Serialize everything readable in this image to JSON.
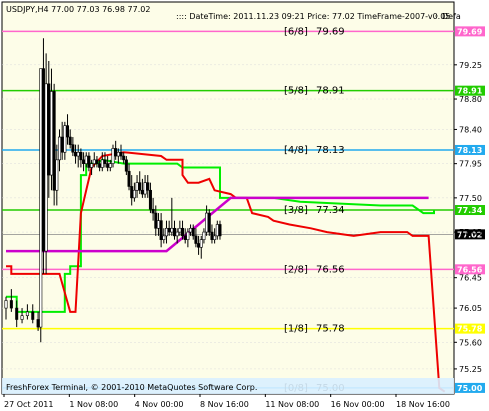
{
  "window": {
    "symbol_header": "USDJPY,H4  77.00 77.03 76.98 77.02",
    "info_line": ":::: DateTime: 2011.11.23 09:21   Price: 77.02   TimeFrame-2007-v0.05",
    "corner_label": "Defa",
    "footer": "FreshForex Terminal, © 2001-2010 MetaQuotes Software Corp."
  },
  "colors": {
    "frame_bg": "#fdfde8",
    "grid": "#dcdcdc",
    "candles": "#000000",
    "fast_line": "#00ee00",
    "slow_line": "#ee0000",
    "magenta_line": "#cc00cc",
    "current_price": "#888888"
  },
  "chart_data": {
    "type": "line",
    "ylim": [
      74.92,
      80.05
    ],
    "y_ticks": [
      "79.25",
      "78.80",
      "78.40",
      "77.95",
      "77.50",
      "77.05",
      "76.45",
      "76.05",
      "75.60",
      "75.25"
    ],
    "x_ticks": [
      "27 Oct 2011",
      "1 Nov 08:00",
      "4 Nov 00:00",
      "8 Nov 16:00",
      "11 Nov 08:00",
      "16 Nov 00:00",
      "18 Nov 16:00"
    ],
    "levels": [
      {
        "tag": "[6/8]",
        "price": 79.69,
        "price_label": "79.69",
        "color": "#ff66cc",
        "label_color": "#ff66cc"
      },
      {
        "tag": "[5/8]",
        "price": 78.91,
        "price_label": "78.91",
        "color": "#22cc00",
        "label_color": "#22bb00"
      },
      {
        "tag": "[4/8]",
        "price": 78.13,
        "price_label": "78.13",
        "color": "#22aaee",
        "label_color": "#22aaee"
      },
      {
        "tag": "[3/8]",
        "price": 77.34,
        "price_label": "77.34",
        "color": "#22cc00",
        "label_color": "#22bb00"
      },
      {
        "tag": "[2/8]",
        "price": 76.56,
        "price_label": "76.56",
        "color": "#ff66cc",
        "label_color": "#ff66cc"
      },
      {
        "tag": "[1/8]",
        "price": 75.78,
        "price_label": "75.78",
        "color": "#ffff00",
        "label_color": "#dddd00"
      },
      {
        "tag": "[0/8]",
        "price": 75.0,
        "price_label": "75.00",
        "color": "#22aaee",
        "label_color": "#22aaee"
      }
    ],
    "current_price": {
      "value": 77.02,
      "label": "77.02"
    },
    "magenta_level": {
      "value": 77.5,
      "label": "77.50"
    },
    "series": [
      {
        "color": "#00ee00",
        "points": [
          [
            0,
            76.2
          ],
          [
            4,
            76.2
          ],
          [
            4,
            76.0
          ],
          [
            14,
            76.0
          ],
          [
            22,
            76.0
          ],
          [
            22,
            76.5
          ],
          [
            24,
            76.5
          ],
          [
            24,
            76.6
          ],
          [
            28,
            76.6
          ],
          [
            28,
            77.8
          ],
          [
            30,
            77.8
          ],
          [
            30,
            77.95
          ],
          [
            34,
            77.95
          ],
          [
            36,
            78.0
          ],
          [
            44,
            77.95
          ],
          [
            58,
            77.95
          ],
          [
            64,
            77.95
          ],
          [
            66,
            77.9
          ],
          [
            80,
            77.9
          ],
          [
            80,
            77.5
          ],
          [
            100,
            77.5
          ],
          [
            110,
            77.45
          ],
          [
            140,
            77.4
          ],
          [
            152,
            77.4
          ],
          [
            156,
            77.3
          ],
          [
            160,
            77.3
          ],
          [
            160,
            77.34
          ]
        ]
      },
      {
        "color": "#ee0000",
        "points": [
          [
            0,
            76.6
          ],
          [
            2,
            76.6
          ],
          [
            2,
            76.5
          ],
          [
            10,
            76.5
          ],
          [
            14,
            76.5
          ],
          [
            20,
            76.5
          ],
          [
            24,
            76.0
          ],
          [
            26,
            76.0
          ],
          [
            28,
            77.3
          ],
          [
            30,
            77.6
          ],
          [
            32,
            77.9
          ],
          [
            36,
            78.05
          ],
          [
            44,
            78.1
          ],
          [
            58,
            78.05
          ],
          [
            60,
            78.0
          ],
          [
            66,
            78.0
          ],
          [
            66,
            77.8
          ],
          [
            68,
            77.7
          ],
          [
            72,
            77.7
          ],
          [
            76,
            77.75
          ],
          [
            78,
            77.6
          ],
          [
            84,
            77.55
          ],
          [
            86,
            77.5
          ],
          [
            90,
            77.5
          ],
          [
            92,
            77.3
          ],
          [
            98,
            77.25
          ],
          [
            100,
            77.2
          ],
          [
            106,
            77.15
          ],
          [
            114,
            77.1
          ],
          [
            120,
            77.05
          ],
          [
            130,
            77.0
          ],
          [
            140,
            77.05
          ],
          [
            150,
            77.05
          ],
          [
            152,
            77.0
          ],
          [
            158,
            77.0
          ],
          [
            162,
            75.0
          ],
          [
            164,
            74.95
          ]
        ]
      }
    ],
    "magenta_series": [
      [
        0,
        76.8
      ],
      [
        40,
        76.8
      ],
      [
        60,
        76.8
      ],
      [
        84,
        77.5
      ],
      [
        116,
        77.5
      ],
      [
        156,
        77.5
      ],
      [
        158,
        77.5
      ]
    ],
    "candles": [
      [
        0,
        76.05,
        76.2,
        75.9,
        76.15
      ],
      [
        2,
        76.15,
        76.3,
        76.0,
        76.05
      ],
      [
        4,
        76.05,
        76.15,
        75.8,
        75.9
      ],
      [
        6,
        75.9,
        76.05,
        75.85,
        75.95
      ],
      [
        8,
        75.95,
        76.1,
        75.9,
        76.0
      ],
      [
        10,
        76.0,
        76.1,
        75.85,
        75.9
      ],
      [
        12,
        75.9,
        76.0,
        75.75,
        75.8
      ],
      [
        13,
        75.8,
        79.0,
        75.6,
        79.2
      ],
      [
        14,
        79.2,
        79.6,
        76.5,
        76.8
      ],
      [
        15,
        76.8,
        79.4,
        76.5,
        79.0
      ],
      [
        16,
        79.0,
        79.3,
        77.5,
        77.8
      ],
      [
        17,
        77.8,
        79.2,
        77.6,
        78.9
      ],
      [
        18,
        78.9,
        79.0,
        77.4,
        77.6
      ],
      [
        19,
        77.6,
        78.2,
        77.4,
        78.0
      ],
      [
        20,
        78.0,
        78.4,
        77.85,
        78.3
      ],
      [
        21,
        78.3,
        78.5,
        78.0,
        78.1
      ],
      [
        22,
        78.1,
        78.5,
        78.0,
        78.45
      ],
      [
        23,
        78.45,
        78.6,
        78.2,
        78.3
      ],
      [
        24,
        78.3,
        78.4,
        78.15,
        78.2
      ],
      [
        25,
        78.2,
        78.3,
        78.05,
        78.1
      ],
      [
        26,
        78.1,
        78.2,
        77.95,
        78.05
      ],
      [
        27,
        78.05,
        78.2,
        77.9,
        78.1
      ],
      [
        28,
        78.1,
        78.15,
        77.9,
        78.0
      ],
      [
        29,
        78.0,
        78.1,
        77.85,
        77.95
      ],
      [
        30,
        77.95,
        78.1,
        77.9,
        78.05
      ],
      [
        31,
        78.05,
        78.1,
        77.85,
        77.9
      ],
      [
        32,
        77.9,
        78.0,
        77.8,
        77.95
      ],
      [
        33,
        77.95,
        78.1,
        77.9,
        78.0
      ],
      [
        34,
        78.0,
        78.05,
        77.9,
        77.95
      ],
      [
        35,
        77.95,
        78.0,
        77.85,
        77.9
      ],
      [
        36,
        77.9,
        78.1,
        77.85,
        78.0
      ],
      [
        37,
        78.0,
        78.1,
        77.9,
        77.95
      ],
      [
        38,
        77.95,
        78.05,
        77.85,
        77.9
      ],
      [
        39,
        77.9,
        78.0,
        77.85,
        77.95
      ],
      [
        40,
        77.95,
        78.2,
        77.9,
        78.15
      ],
      [
        41,
        78.15,
        78.25,
        78.0,
        78.05
      ],
      [
        42,
        78.05,
        78.15,
        77.95,
        78.1
      ],
      [
        43,
        78.1,
        78.2,
        78.0,
        78.05
      ],
      [
        44,
        78.05,
        78.1,
        77.95,
        78.0
      ],
      [
        45,
        78.0,
        78.05,
        77.8,
        77.85
      ],
      [
        46,
        77.85,
        77.95,
        77.6,
        77.65
      ],
      [
        47,
        77.65,
        77.8,
        77.4,
        77.5
      ],
      [
        48,
        77.5,
        77.7,
        77.45,
        77.6
      ],
      [
        49,
        77.6,
        77.8,
        77.5,
        77.7
      ],
      [
        50,
        77.7,
        77.85,
        77.55,
        77.6
      ],
      [
        51,
        77.6,
        77.75,
        77.5,
        77.55
      ],
      [
        52,
        77.55,
        77.8,
        77.5,
        77.7
      ],
      [
        53,
        77.7,
        77.8,
        77.5,
        77.6
      ],
      [
        54,
        77.6,
        77.7,
        77.3,
        77.35
      ],
      [
        55,
        77.35,
        77.5,
        77.2,
        77.3
      ],
      [
        56,
        77.3,
        77.4,
        77.0,
        77.1
      ],
      [
        57,
        77.1,
        77.3,
        77.0,
        77.2
      ],
      [
        58,
        77.2,
        77.3,
        76.85,
        76.95
      ],
      [
        59,
        76.95,
        77.1,
        76.9,
        77.0
      ],
      [
        60,
        77.0,
        77.2,
        76.9,
        77.1
      ],
      [
        61,
        77.1,
        77.2,
        77.0,
        77.05
      ],
      [
        62,
        77.05,
        77.5,
        77.0,
        77.1
      ],
      [
        63,
        77.1,
        77.2,
        76.95,
        77.0
      ],
      [
        64,
        77.0,
        77.1,
        76.9,
        77.05
      ],
      [
        65,
        77.05,
        77.2,
        77.0,
        77.1
      ],
      [
        66,
        77.1,
        77.2,
        76.95,
        77.0
      ],
      [
        67,
        77.0,
        77.1,
        76.9,
        76.95
      ],
      [
        68,
        76.95,
        77.1,
        76.85,
        77.05
      ],
      [
        69,
        77.05,
        77.15,
        77.0,
        77.1
      ],
      [
        70,
        77.1,
        77.15,
        76.95,
        77.0
      ],
      [
        71,
        77.0,
        77.1,
        76.85,
        76.9
      ],
      [
        72,
        76.9,
        77.0,
        76.75,
        76.85
      ],
      [
        73,
        76.85,
        77.0,
        76.7,
        76.95
      ],
      [
        74,
        76.95,
        77.1,
        76.9,
        77.05
      ],
      [
        75,
        77.05,
        77.4,
        77.0,
        77.3
      ],
      [
        76,
        77.3,
        77.35,
        77.0,
        77.05
      ],
      [
        77,
        77.05,
        77.15,
        76.9,
        76.95
      ],
      [
        78,
        76.95,
        77.1,
        76.9,
        77.0
      ],
      [
        79,
        77.0,
        77.2,
        76.95,
        77.15
      ],
      [
        80,
        77.15,
        77.2,
        76.95,
        77.0
      ]
    ],
    "x_max": 166
  }
}
